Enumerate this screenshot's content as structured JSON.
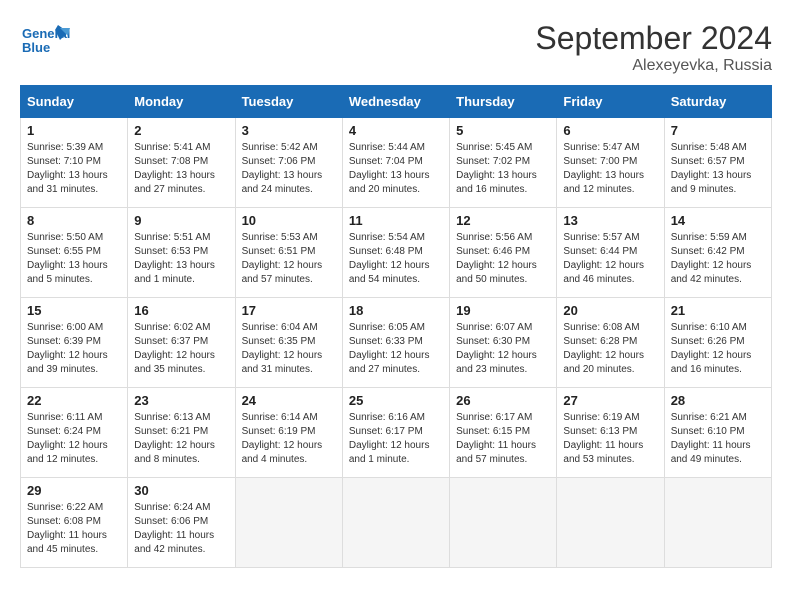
{
  "logo": {
    "line1": "General",
    "line2": "Blue"
  },
  "title": "September 2024",
  "subtitle": "Alexeyevka, Russia",
  "days_header": [
    "Sunday",
    "Monday",
    "Tuesday",
    "Wednesday",
    "Thursday",
    "Friday",
    "Saturday"
  ],
  "weeks": [
    [
      {
        "num": "1",
        "sunrise": "Sunrise: 5:39 AM",
        "sunset": "Sunset: 7:10 PM",
        "daylight": "Daylight: 13 hours and 31 minutes."
      },
      {
        "num": "2",
        "sunrise": "Sunrise: 5:41 AM",
        "sunset": "Sunset: 7:08 PM",
        "daylight": "Daylight: 13 hours and 27 minutes."
      },
      {
        "num": "3",
        "sunrise": "Sunrise: 5:42 AM",
        "sunset": "Sunset: 7:06 PM",
        "daylight": "Daylight: 13 hours and 24 minutes."
      },
      {
        "num": "4",
        "sunrise": "Sunrise: 5:44 AM",
        "sunset": "Sunset: 7:04 PM",
        "daylight": "Daylight: 13 hours and 20 minutes."
      },
      {
        "num": "5",
        "sunrise": "Sunrise: 5:45 AM",
        "sunset": "Sunset: 7:02 PM",
        "daylight": "Daylight: 13 hours and 16 minutes."
      },
      {
        "num": "6",
        "sunrise": "Sunrise: 5:47 AM",
        "sunset": "Sunset: 7:00 PM",
        "daylight": "Daylight: 13 hours and 12 minutes."
      },
      {
        "num": "7",
        "sunrise": "Sunrise: 5:48 AM",
        "sunset": "Sunset: 6:57 PM",
        "daylight": "Daylight: 13 hours and 9 minutes."
      }
    ],
    [
      {
        "num": "8",
        "sunrise": "Sunrise: 5:50 AM",
        "sunset": "Sunset: 6:55 PM",
        "daylight": "Daylight: 13 hours and 5 minutes."
      },
      {
        "num": "9",
        "sunrise": "Sunrise: 5:51 AM",
        "sunset": "Sunset: 6:53 PM",
        "daylight": "Daylight: 13 hours and 1 minute."
      },
      {
        "num": "10",
        "sunrise": "Sunrise: 5:53 AM",
        "sunset": "Sunset: 6:51 PM",
        "daylight": "Daylight: 12 hours and 57 minutes."
      },
      {
        "num": "11",
        "sunrise": "Sunrise: 5:54 AM",
        "sunset": "Sunset: 6:48 PM",
        "daylight": "Daylight: 12 hours and 54 minutes."
      },
      {
        "num": "12",
        "sunrise": "Sunrise: 5:56 AM",
        "sunset": "Sunset: 6:46 PM",
        "daylight": "Daylight: 12 hours and 50 minutes."
      },
      {
        "num": "13",
        "sunrise": "Sunrise: 5:57 AM",
        "sunset": "Sunset: 6:44 PM",
        "daylight": "Daylight: 12 hours and 46 minutes."
      },
      {
        "num": "14",
        "sunrise": "Sunrise: 5:59 AM",
        "sunset": "Sunset: 6:42 PM",
        "daylight": "Daylight: 12 hours and 42 minutes."
      }
    ],
    [
      {
        "num": "15",
        "sunrise": "Sunrise: 6:00 AM",
        "sunset": "Sunset: 6:39 PM",
        "daylight": "Daylight: 12 hours and 39 minutes."
      },
      {
        "num": "16",
        "sunrise": "Sunrise: 6:02 AM",
        "sunset": "Sunset: 6:37 PM",
        "daylight": "Daylight: 12 hours and 35 minutes."
      },
      {
        "num": "17",
        "sunrise": "Sunrise: 6:04 AM",
        "sunset": "Sunset: 6:35 PM",
        "daylight": "Daylight: 12 hours and 31 minutes."
      },
      {
        "num": "18",
        "sunrise": "Sunrise: 6:05 AM",
        "sunset": "Sunset: 6:33 PM",
        "daylight": "Daylight: 12 hours and 27 minutes."
      },
      {
        "num": "19",
        "sunrise": "Sunrise: 6:07 AM",
        "sunset": "Sunset: 6:30 PM",
        "daylight": "Daylight: 12 hours and 23 minutes."
      },
      {
        "num": "20",
        "sunrise": "Sunrise: 6:08 AM",
        "sunset": "Sunset: 6:28 PM",
        "daylight": "Daylight: 12 hours and 20 minutes."
      },
      {
        "num": "21",
        "sunrise": "Sunrise: 6:10 AM",
        "sunset": "Sunset: 6:26 PM",
        "daylight": "Daylight: 12 hours and 16 minutes."
      }
    ],
    [
      {
        "num": "22",
        "sunrise": "Sunrise: 6:11 AM",
        "sunset": "Sunset: 6:24 PM",
        "daylight": "Daylight: 12 hours and 12 minutes."
      },
      {
        "num": "23",
        "sunrise": "Sunrise: 6:13 AM",
        "sunset": "Sunset: 6:21 PM",
        "daylight": "Daylight: 12 hours and 8 minutes."
      },
      {
        "num": "24",
        "sunrise": "Sunrise: 6:14 AM",
        "sunset": "Sunset: 6:19 PM",
        "daylight": "Daylight: 12 hours and 4 minutes."
      },
      {
        "num": "25",
        "sunrise": "Sunrise: 6:16 AM",
        "sunset": "Sunset: 6:17 PM",
        "daylight": "Daylight: 12 hours and 1 minute."
      },
      {
        "num": "26",
        "sunrise": "Sunrise: 6:17 AM",
        "sunset": "Sunset: 6:15 PM",
        "daylight": "Daylight: 11 hours and 57 minutes."
      },
      {
        "num": "27",
        "sunrise": "Sunrise: 6:19 AM",
        "sunset": "Sunset: 6:13 PM",
        "daylight": "Daylight: 11 hours and 53 minutes."
      },
      {
        "num": "28",
        "sunrise": "Sunrise: 6:21 AM",
        "sunset": "Sunset: 6:10 PM",
        "daylight": "Daylight: 11 hours and 49 minutes."
      }
    ],
    [
      {
        "num": "29",
        "sunrise": "Sunrise: 6:22 AM",
        "sunset": "Sunset: 6:08 PM",
        "daylight": "Daylight: 11 hours and 45 minutes."
      },
      {
        "num": "30",
        "sunrise": "Sunrise: 6:24 AM",
        "sunset": "Sunset: 6:06 PM",
        "daylight": "Daylight: 11 hours and 42 minutes."
      },
      null,
      null,
      null,
      null,
      null
    ]
  ]
}
